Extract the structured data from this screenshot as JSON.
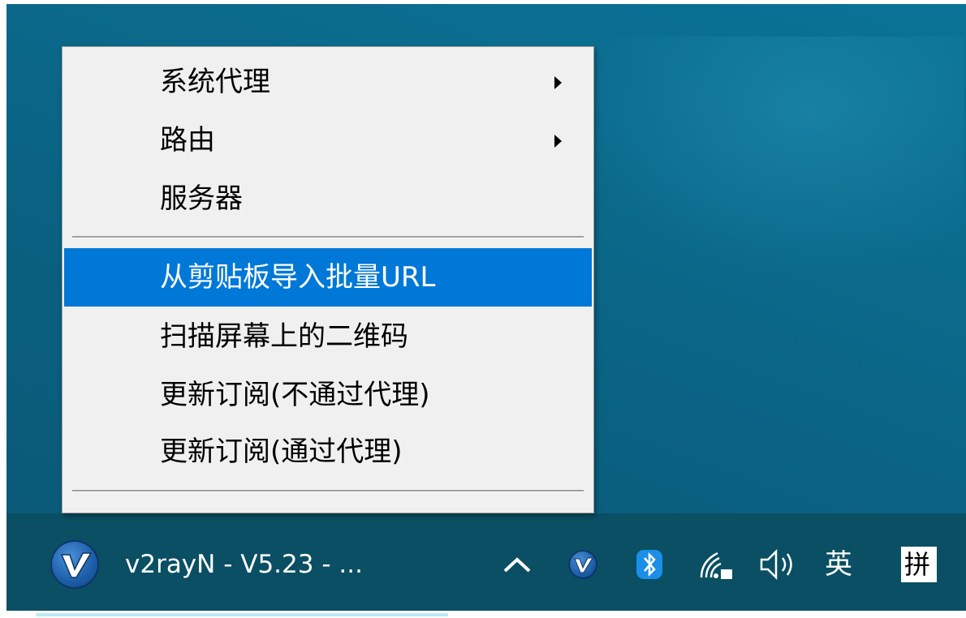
{
  "context_menu": {
    "items": [
      {
        "label": "系统代理",
        "has_submenu": true
      },
      {
        "label": "路由",
        "has_submenu": true
      },
      {
        "label": "服务器",
        "has_submenu": false
      },
      {
        "label": "从剪贴板导入批量URL",
        "highlighted": true
      },
      {
        "label": "扫描屏幕上的二维码"
      },
      {
        "label": "更新订阅(不通过代理)"
      },
      {
        "label": "更新订阅(通过代理)"
      }
    ],
    "highlight_color": "#0078d7"
  },
  "taskbar": {
    "app": {
      "title": "v2rayN - V5.23 - ...",
      "icon": "v2rayn-logo-icon"
    },
    "tray": {
      "overflow_icon": "^",
      "items": [
        "v2rayn-tray-icon",
        "bluetooth-icon",
        "wifi-icon",
        "volume-icon"
      ],
      "input_language": "英",
      "input_mode": "拼"
    },
    "background": "#0a4f63"
  },
  "desktop": {
    "background": "#0a6a8c"
  }
}
